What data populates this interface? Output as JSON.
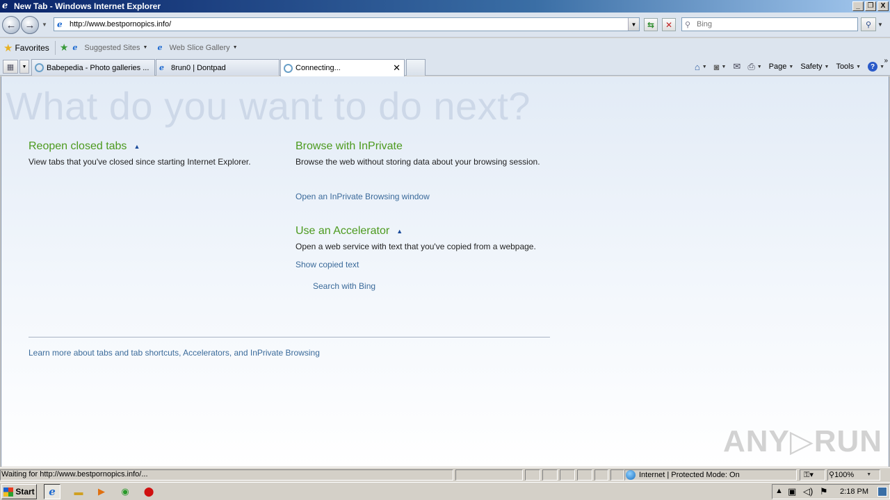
{
  "window": {
    "title": "New Tab - Windows Internet Explorer",
    "minimize": "_",
    "restore": "❐",
    "close": "X"
  },
  "nav": {
    "back": "←",
    "forward": "→",
    "address": "http://www.bestpornopics.info/",
    "search_placeholder": "Bing"
  },
  "favorites_bar": {
    "favorites_label": "Favorites",
    "suggested_sites": "Suggested Sites",
    "web_slice_gallery": "Web Slice Gallery"
  },
  "tabs": [
    {
      "label": "Babepedia - Photo galleries ..."
    },
    {
      "label": "8run0 | Dontpad"
    },
    {
      "label": "Connecting...",
      "active": true
    }
  ],
  "command_bar": {
    "page": "Page",
    "safety": "Safety",
    "tools": "Tools",
    "help": "?"
  },
  "content": {
    "heading": "What do you want to do next?",
    "reopen": {
      "title": "Reopen closed tabs",
      "desc": "View tabs that you've closed since starting Internet Explorer."
    },
    "inprivate": {
      "title": "Browse with InPrivate",
      "desc": "Browse the web without storing data about your browsing session.",
      "link": "Open an InPrivate Browsing window"
    },
    "accelerator": {
      "title": "Use an Accelerator",
      "desc": "Open a web service with text that you've copied from a webpage.",
      "show_copied": "Show copied text",
      "search_bing": "Search with Bing"
    },
    "learn_more": "Learn more about tabs and tab shortcuts, Accelerators, and InPrivate Browsing",
    "watermark": "ANY▷RUN"
  },
  "statusbar": {
    "status": "Waiting for http://www.bestpornopics.info/...",
    "zone": "Internet | Protected Mode: On",
    "zoom": "100%"
  },
  "taskbar": {
    "start": "Start",
    "clock": "2:18 PM"
  },
  "colors": {
    "section_title": "#4c9a1e",
    "link": "#3a6a9a",
    "heading_watermark": "#cdd8e8"
  }
}
